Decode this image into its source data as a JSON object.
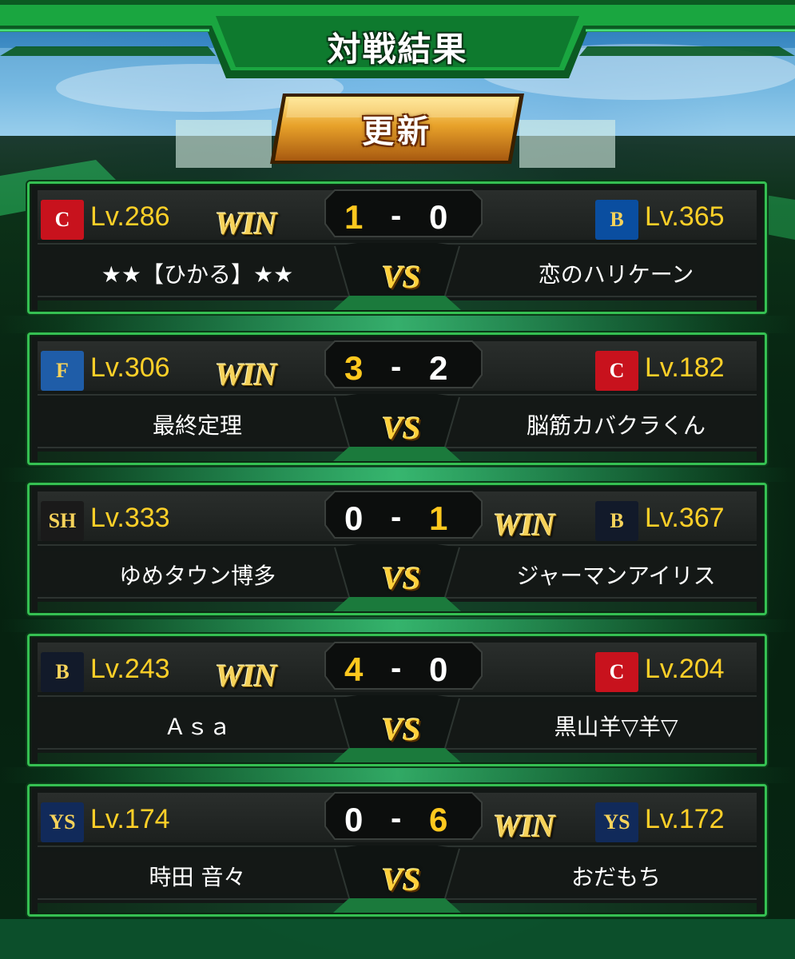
{
  "header": {
    "title": "対戦結果"
  },
  "refresh_button": {
    "label": "更新"
  },
  "colors": {
    "accent_green": "#35c052",
    "gold": "#ffd028",
    "win_gold": "#f5d25a"
  },
  "matches": [
    {
      "left": {
        "team_icon": "carp-logo-icon",
        "logo_text": "C",
        "logo_bg": "#c8121d",
        "level": "Lv.286",
        "name": "★★【ひかる】★★",
        "score": "1",
        "win": "WIN"
      },
      "right": {
        "team_icon": "baystars-logo-icon",
        "logo_text": "B",
        "logo_bg": "#0a4ea0",
        "level": "Lv.365",
        "name": "恋のハリケーン",
        "score": "0",
        "win": ""
      },
      "dash": "-",
      "vs": "VS"
    },
    {
      "left": {
        "team_icon": "fighters-logo-icon",
        "logo_text": "F",
        "logo_bg": "#1f5da8",
        "level": "Lv.306",
        "name": "最終定理",
        "score": "3",
        "win": "WIN"
      },
      "right": {
        "team_icon": "carp-logo-icon",
        "logo_text": "C",
        "logo_bg": "#c8121d",
        "level": "Lv.182",
        "name": "脳筋カバクラくん",
        "score": "2",
        "win": ""
      },
      "dash": "-",
      "vs": "VS"
    },
    {
      "left": {
        "team_icon": "hawks-logo-icon",
        "logo_text": "SH",
        "logo_bg": "#1a1a1a",
        "level": "Lv.333",
        "name": "ゆめタウン博多",
        "score": "0",
        "win": ""
      },
      "right": {
        "team_icon": "buffaloes-logo-icon",
        "logo_text": "B",
        "logo_bg": "#121a2a",
        "level": "Lv.367",
        "name": "ジャーマンアイリス",
        "score": "1",
        "win": "WIN"
      },
      "dash": "-",
      "vs": "VS"
    },
    {
      "left": {
        "team_icon": "buffaloes-logo-icon",
        "logo_text": "B",
        "logo_bg": "#121a2a",
        "level": "Lv.243",
        "name": "Ａｓａ",
        "score": "4",
        "win": "WIN"
      },
      "right": {
        "team_icon": "carp-logo-icon",
        "logo_text": "C",
        "logo_bg": "#c8121d",
        "level": "Lv.204",
        "name": "黒山羊▽羊▽",
        "score": "0",
        "win": ""
      },
      "dash": "-",
      "vs": "VS"
    },
    {
      "left": {
        "team_icon": "swallows-logo-icon",
        "logo_text": "YS",
        "logo_bg": "#112a5a",
        "level": "Lv.174",
        "name": "時田 音々",
        "score": "0",
        "win": ""
      },
      "right": {
        "team_icon": "swallows-logo-icon",
        "logo_text": "YS",
        "logo_bg": "#112a5a",
        "level": "Lv.172",
        "name": "おだもち",
        "score": "6",
        "win": "WIN"
      },
      "dash": "-",
      "vs": "VS"
    }
  ]
}
